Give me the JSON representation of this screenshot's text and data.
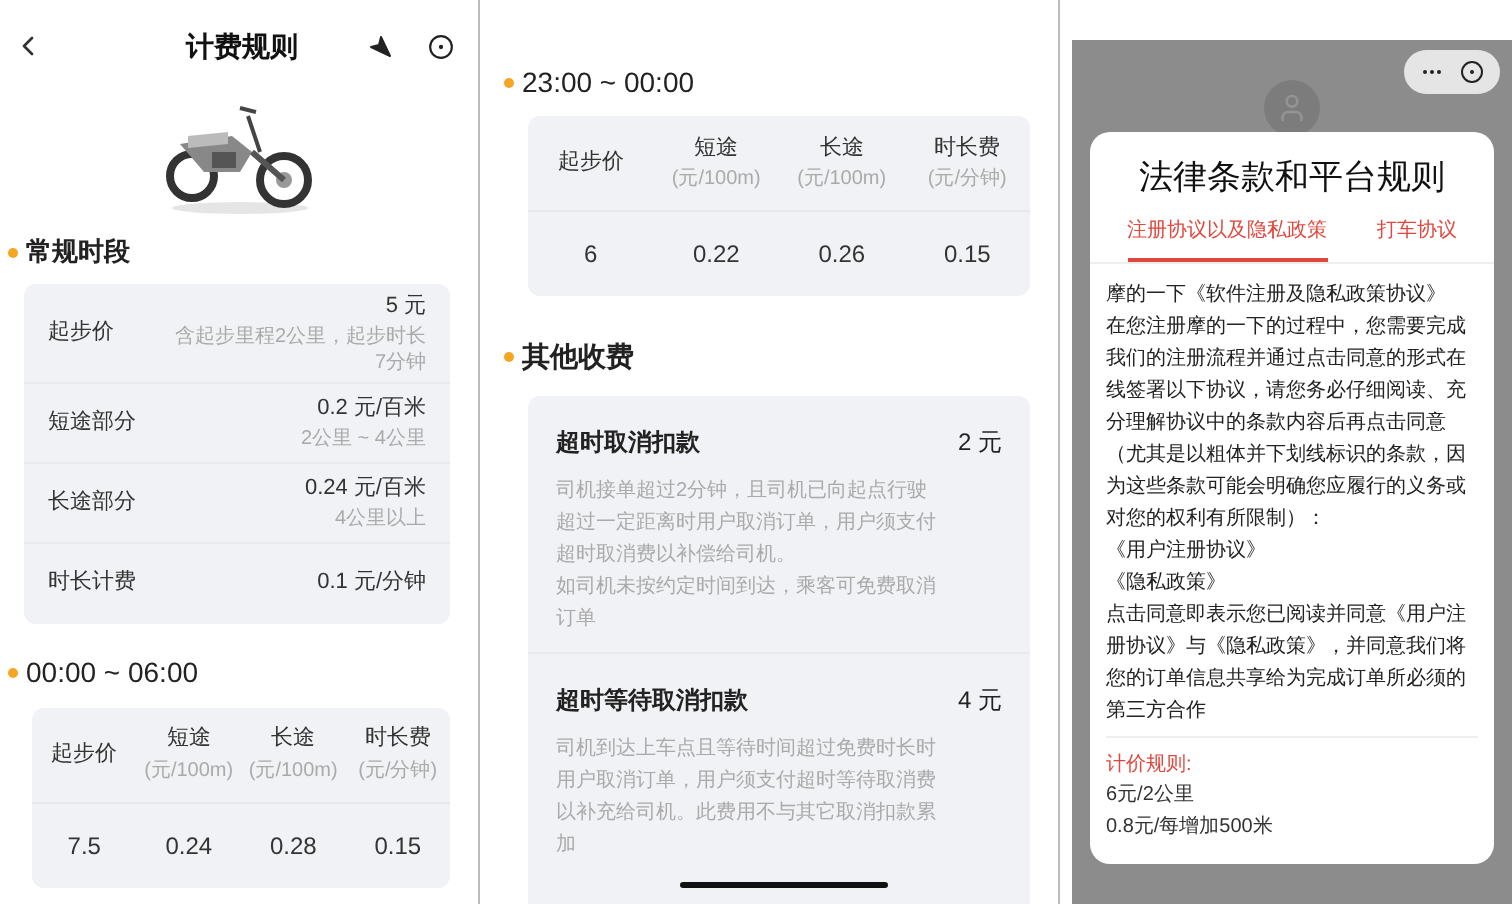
{
  "pricing": {
    "title": "计费规则",
    "regular": {
      "title": "常规时段",
      "rows": [
        {
          "label": "起步价",
          "value": "5 元",
          "note": "含起步里程2公里，起步时长7分钟"
        },
        {
          "label": "短途部分",
          "value": "0.2 元/百米",
          "note": "2公里 ~ 4公里"
        },
        {
          "label": "长途部分",
          "value": "0.24 元/百米",
          "note": "4公里以上"
        },
        {
          "label": "时长计费",
          "value": "0.1 元/分钟"
        }
      ]
    },
    "time_tables": [
      {
        "title": "00:00 ~ 06:00",
        "headers": [
          {
            "label": "起步价"
          },
          {
            "label": "短途",
            "unit": "(元/100m)"
          },
          {
            "label": "长途",
            "unit": "(元/100m)"
          },
          {
            "label": "时长费",
            "unit": "(元/分钟)"
          }
        ],
        "values": [
          "7.5",
          "0.24",
          "0.28",
          "0.15"
        ]
      },
      {
        "title": "23:00 ~ 00:00",
        "headers": [
          {
            "label": "起步价"
          },
          {
            "label": "短途",
            "unit": "(元/100m)"
          },
          {
            "label": "长途",
            "unit": "(元/100m)"
          },
          {
            "label": "时长费",
            "unit": "(元/分钟)"
          }
        ],
        "values": [
          "6",
          "0.22",
          "0.26",
          "0.15"
        ]
      }
    ],
    "other": {
      "title": "其他收费",
      "items": [
        {
          "name": "超时取消扣款",
          "amount": "2 元",
          "description": [
            "司机接单超过2分钟，且司机已向起点行驶超过一定距离时用户取消订单，用户须支付超时取消费以补偿给司机。",
            "如司机未按约定时间到达，乘客可免费取消订单"
          ]
        },
        {
          "name": "超时等待取消扣款",
          "amount": "4 元",
          "description": [
            "司机到达上车点且等待时间超过免费时长时用户取消订单，用户须支付超时等待取消费以补充给司机。此费用不与其它取消扣款累加"
          ]
        }
      ]
    }
  },
  "dialog": {
    "title": "法律条款和平台规则",
    "tabs": [
      {
        "label": "注册协议以及隐私政策",
        "selected": true
      },
      {
        "label": "打车协议",
        "selected": false
      }
    ],
    "paragraphs": [
      "摩的一下《软件注册及隐私政策协议》",
      "在您注册摩的一下的过程中，您需要完成我们的注册流程并通过点击同意的形式在线签署以下协议，请您务必仔细阅读、充分理解协议中的条款内容后再点击同意（尤其是以粗体并下划线标识的条款，因为这些条款可能会明确您应履行的义务或对您的权利有所限制）：",
      "《用户注册协议》",
      "《隐私政策》",
      "点击同意即表示您已阅读并同意《用户注册协议》与《隐私政策》，并同意我们将您的订单信息共享给为完成订单所必须的第三方合作"
    ],
    "rules_title": "计价规则:",
    "rules": [
      "6元/2公里",
      "0.8元/每增加500米"
    ]
  }
}
